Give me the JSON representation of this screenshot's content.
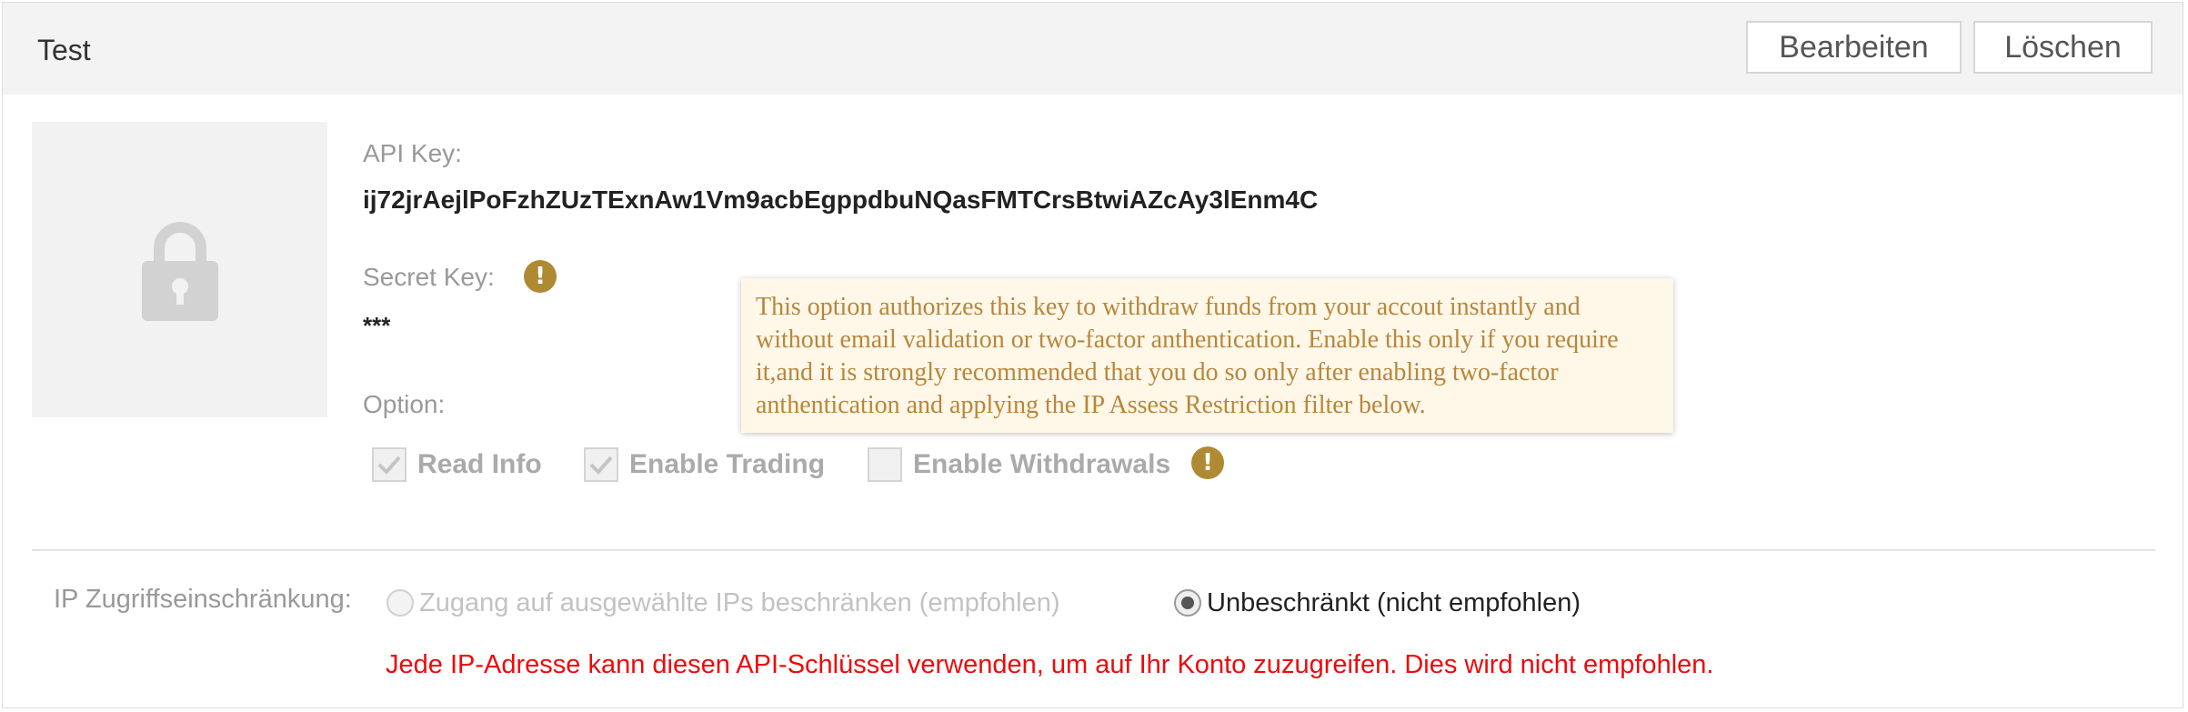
{
  "header": {
    "title": "Test",
    "edit_label": "Bearbeiten",
    "delete_label": "Löschen"
  },
  "api_key": {
    "label": "API Key:",
    "value": "ij72jrAejlPoFzhZUzTExnAw1Vm9acbEgppdbuNQasFMTCrsBtwiAZcAy3lEnm4C"
  },
  "secret_key": {
    "label": "Secret Key:",
    "value": "***",
    "warning_glyph": "!"
  },
  "tooltip": {
    "text": "This option authorizes this key to withdraw funds from your accout instantly and without email validation or two-factor anthentication. Enable this only if you require it,and it is strongly recommended that you do so only after enabling two-factor anthentication and applying the IP Assess Restriction filter below."
  },
  "options": {
    "label": "Option:",
    "items": [
      {
        "label": "Read Info",
        "checked": true,
        "disabled": true
      },
      {
        "label": "Enable Trading",
        "checked": true,
        "disabled": true
      },
      {
        "label": "Enable Withdrawals",
        "checked": false,
        "disabled": true
      }
    ],
    "warning_glyph": "!"
  },
  "ip_restriction": {
    "label": "IP Zugriffseinschränkung:",
    "options": [
      {
        "label": "Zugang auf ausgewählte IPs beschränken (empfohlen)",
        "selected": false
      },
      {
        "label": "Unbeschränkt (nicht empfohlen)",
        "selected": true
      }
    ],
    "warning": "Jede IP-Adresse kann diesen API-Schlüssel verwenden, um auf Ihr Konto zuzugreifen. Dies wird nicht empfohlen."
  },
  "colors": {
    "warning_icon": "#b08a32",
    "tooltip_bg": "#fff7e8",
    "tooltip_text": "#b8863b",
    "danger_text": "#ee0a0a"
  },
  "icons": {
    "lock": "lock-icon",
    "warning": "exclamation-icon",
    "check": "check-icon"
  }
}
